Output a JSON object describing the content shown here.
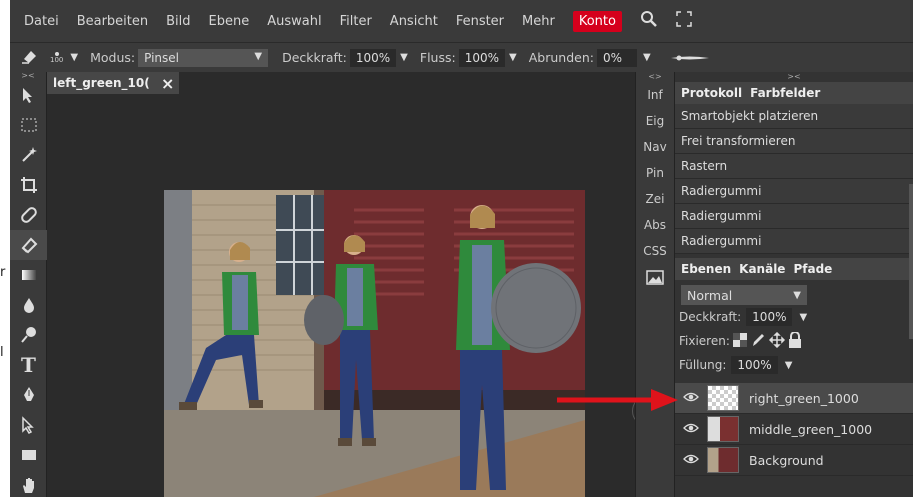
{
  "menu": [
    "Datei",
    "Bearbeiten",
    "Bild",
    "Ebene",
    "Auswahl",
    "Filter",
    "Ansicht",
    "Fenster",
    "Mehr"
  ],
  "konto_label": "Konto",
  "options": {
    "brush_size": "100",
    "modus_label": "Modus:",
    "modus_value": "Pinsel",
    "deckkraft_label": "Deckkraft:",
    "deckkraft_value": "100%",
    "fluss_label": "Fluss:",
    "fluss_value": "100%",
    "abrunden_label": "Abrunden:",
    "abrunden_value": "0%"
  },
  "document_tab": {
    "title": "left_green_10(",
    "close": "×"
  },
  "sidebar_collapse": "<>",
  "panel_collapse": "><",
  "toolbar_collapse": "><",
  "side_shortcuts": [
    "Inf",
    "Eig",
    "Nav",
    "Pin",
    "Zei",
    "Abs",
    "CSS"
  ],
  "history": {
    "tabs": [
      "Protokoll",
      "Farbfelder"
    ],
    "items": [
      "Smartobjekt platzieren",
      "Frei transformieren",
      "Rastern",
      "Radiergummi",
      "Radiergummi",
      "Radiergummi"
    ]
  },
  "layers": {
    "tabs": [
      "Ebenen",
      "Kanäle",
      "Pfade"
    ],
    "blend_mode": "Normal",
    "deckkraft_label": "Deckkraft:",
    "deckkraft_value": "100%",
    "fixieren_label": "Fixieren:",
    "fuellung_label": "Füllung:",
    "fuellung_value": "100%",
    "items": [
      "right_green_1000",
      "middle_green_1000",
      "Background"
    ]
  },
  "edge_text": {
    "right": "r",
    "left": "l"
  },
  "colors": {
    "accent": "#d5001c",
    "arrow": "#e0131b"
  }
}
